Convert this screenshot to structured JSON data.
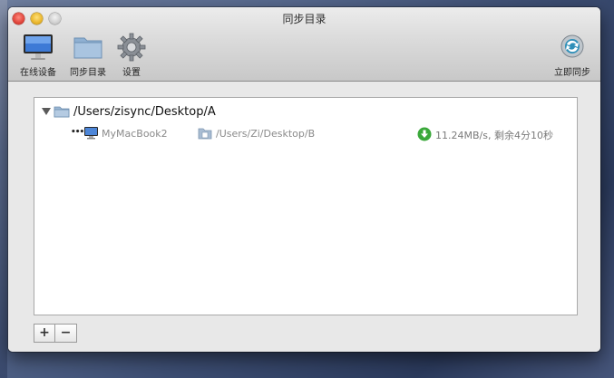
{
  "window": {
    "title": "同步目录"
  },
  "toolbar": {
    "online_devices": "在线设备",
    "sync_dirs": "同步目录",
    "settings": "设置",
    "sync_now": "立即同步"
  },
  "tree": {
    "root_path": "/Users/zisync/Desktop/A",
    "children": [
      {
        "device": "MyMacBook2",
        "remote_path": "/Users/Zi/Desktop/B",
        "status": "11.24MB/s, 剩余4分10秒"
      }
    ]
  },
  "buttons": {
    "add": "+",
    "remove": "−"
  },
  "colors": {
    "status_green": "#3aa83a",
    "folder_blue": "#9bb7d4"
  }
}
